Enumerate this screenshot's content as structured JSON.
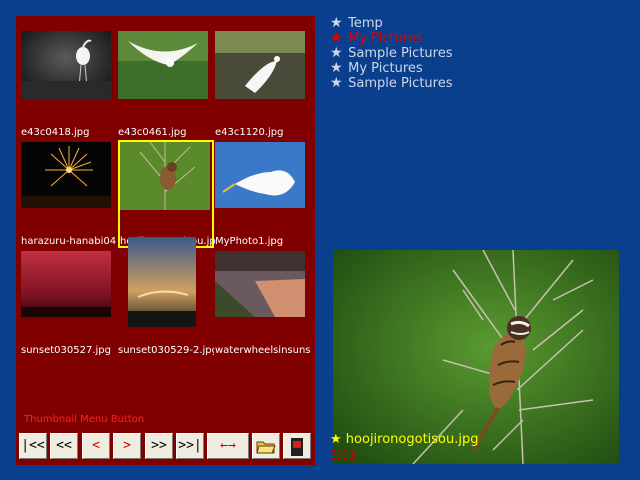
{
  "folders": [
    {
      "label": "Temp",
      "active": false
    },
    {
      "label": "My Pictures",
      "active": true
    },
    {
      "label": "Sample Pictures",
      "active": false
    },
    {
      "label": "My Pictures",
      "active": false
    },
    {
      "label": "Sample Pictures",
      "active": false
    }
  ],
  "thumbnails": [
    {
      "caption": "e43c0418.jpg"
    },
    {
      "caption": "e43c0461.jpg"
    },
    {
      "caption": "e43c1120.jpg"
    },
    {
      "caption": "harazuru-hanabi04.jpg"
    },
    {
      "caption": "hoojironogotisou.jpg"
    },
    {
      "caption": "MyPhoto1.jpg"
    },
    {
      "caption": "sunset030527.jpg"
    },
    {
      "caption": "sunset030529-2.jpg"
    },
    {
      "caption": "waterwheelsinsunset.jpg"
    }
  ],
  "menu": {
    "label": "Thumbnail Menu Button",
    "buttons": [
      {
        "label": "|<<",
        "icon": "first-icon"
      },
      {
        "label": "<<",
        "icon": "prev-page-icon"
      },
      {
        "label": "<",
        "icon": "prev-icon"
      },
      {
        "label": ">",
        "icon": "next-icon"
      },
      {
        "label": ">>",
        "icon": "next-page-icon"
      },
      {
        "label": ">>|",
        "icon": "last-icon"
      },
      {
        "label": "←→",
        "icon": "swap-icon"
      },
      {
        "label": "",
        "icon": "folder-open-icon"
      },
      {
        "label": "",
        "icon": "device-icon"
      }
    ]
  },
  "preview": {
    "filename": "hoojironogotisou.jpg",
    "counter": "5/12"
  },
  "colors": {
    "background": "#0a3f8e",
    "panel": "#800000",
    "selection": "#ffff00",
    "active_folder": "#e00000"
  }
}
